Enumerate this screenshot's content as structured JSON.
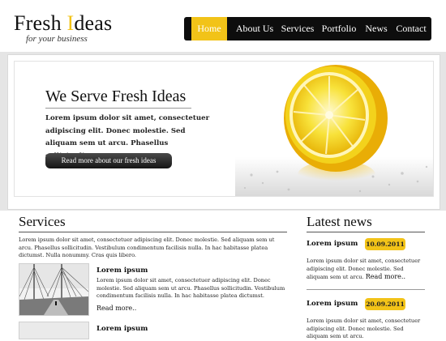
{
  "brand": {
    "title_a": "Fresh ",
    "title_b": "I",
    "title_c": "deas",
    "tagline": "for your business"
  },
  "nav": [
    "Home",
    "About Us",
    "Services",
    "Portfolio",
    "News",
    "Contact"
  ],
  "hero": {
    "title": "We Serve Fresh Ideas",
    "text": "Lorem ipsum dolor sit amet, consectetuer adipiscing elit. Donec molestie. Sed aliquam sem ut arcu. Phasellus sollicitudin.",
    "button": "Read more about our fresh ideas"
  },
  "services": {
    "heading": "Services",
    "intro": "Lorem ipsum dolor sit amet, consectetuer adipiscing elit. Donec molestie. Sed aliquam sem ut arcu. Phasellus sollicitudin. Vestibulum condimentum facilisis nulla. In hac habitasse platea dictumst. Nulla nonummy. Cras quis libero.",
    "items": [
      {
        "title": "Lorem ipsum",
        "text": "Lorem ipsum dolor sit amet, consectetuer adipiscing elit. Donec molestie. Sed aliquam sem ut arcu. Phasellus sollicitudin. Vestibulum condimentum facilisis nulla. In hac habitasse platea dictumst.",
        "more": "Read more.."
      },
      {
        "title": "Lorem ipsum"
      }
    ]
  },
  "news": {
    "heading": "Latest news",
    "items": [
      {
        "title": "Lorem ipsum",
        "date": "10.09.2011",
        "text": "Lorem ipsum dolor sit amet, consectetuer adipiscing elit. Donec molestie. Sed aliquam sem ut arcu.",
        "more": "Read more.."
      },
      {
        "title": "Lorem ipsum",
        "date": "20.09.2011",
        "text": "Lorem ipsum dolor sit amet, consectetuer adipiscing elit. Donec molestie. Sed aliquam sem ut arcu."
      }
    ]
  },
  "colors": {
    "accent": "#f2c318",
    "nav_bg": "#0d0d0d"
  }
}
